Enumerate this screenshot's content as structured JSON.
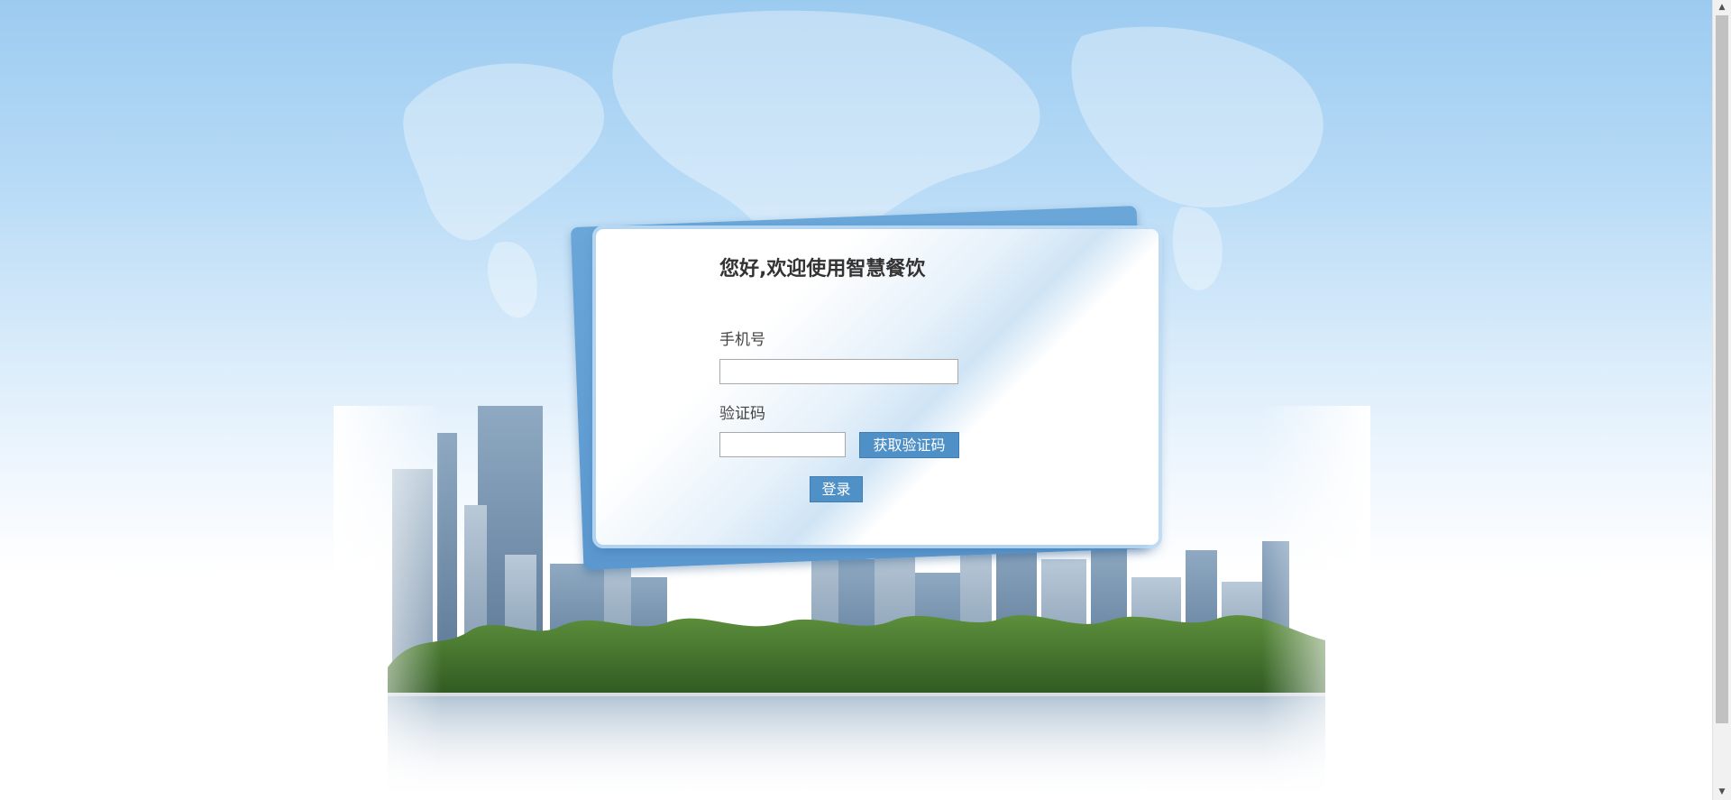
{
  "login": {
    "title": "您好,欢迎使用智慧餐饮",
    "phone_label": "手机号",
    "phone_value": "",
    "code_label": "验证码",
    "code_value": "",
    "get_code_button": "获取验证码",
    "login_button": "登录"
  },
  "icons": {
    "scroll_up": "▲",
    "scroll_down": "▼"
  },
  "colors": {
    "button": "#4f90c6",
    "sky_top": "#9ccbf0",
    "card_back": "#5b98cf"
  }
}
